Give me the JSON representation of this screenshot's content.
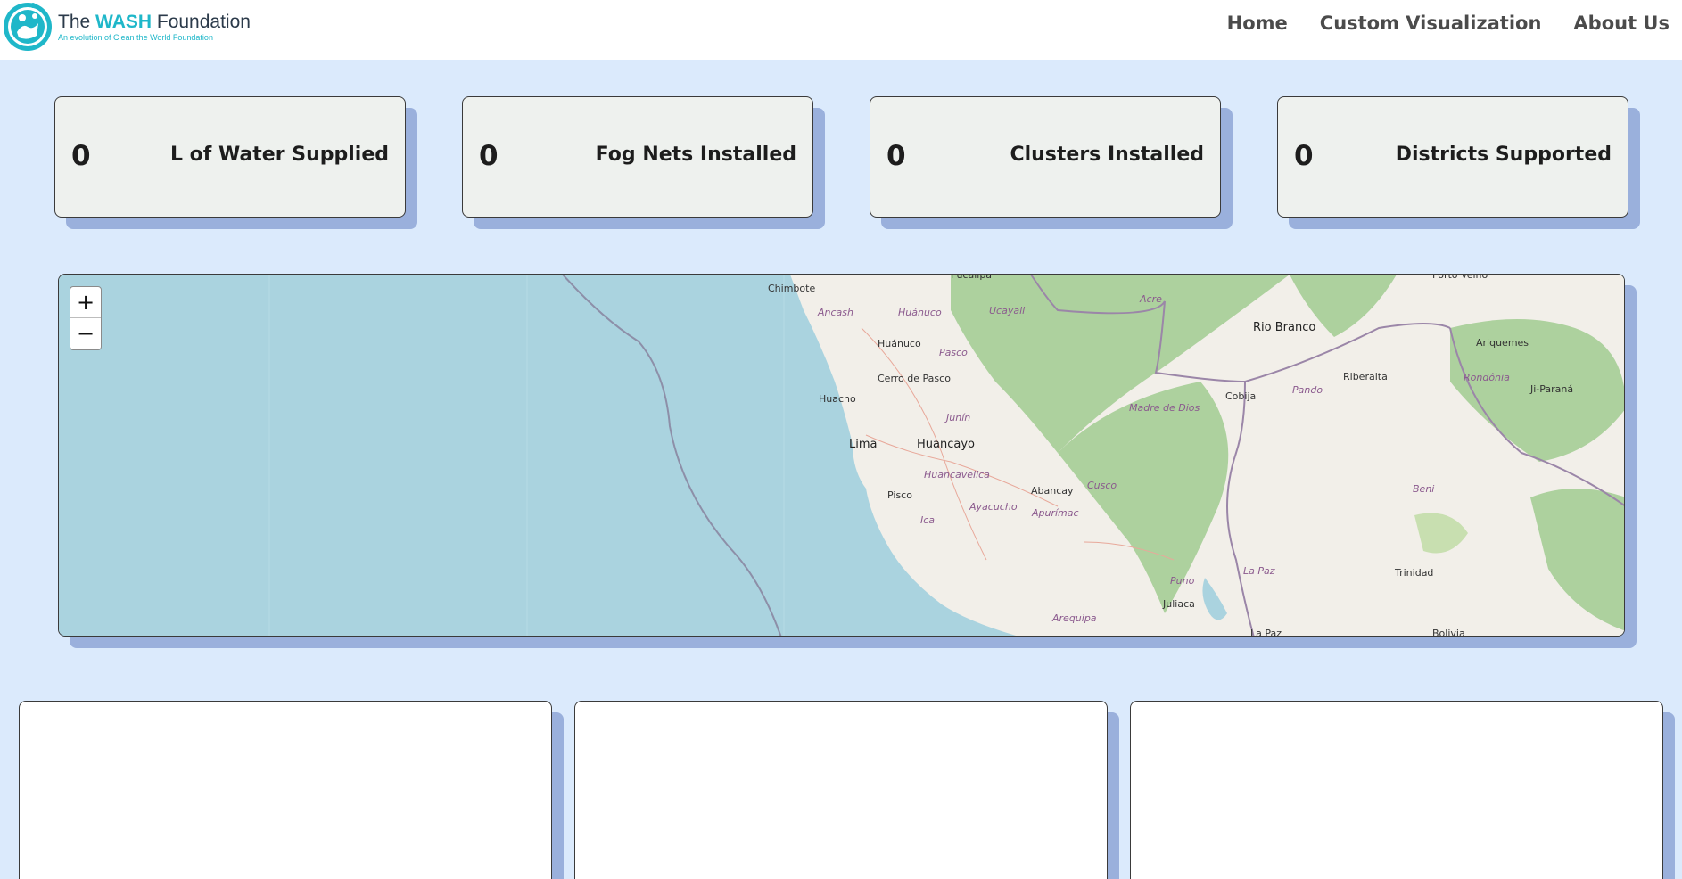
{
  "header": {
    "logo_prefix": "The ",
    "logo_highlight": "WASH",
    "logo_suffix": " Foundation",
    "logo_tagline": "An evolution of Clean the World Foundation",
    "nav": [
      "Home",
      "Custom Visualization",
      "About Us"
    ]
  },
  "stats": [
    {
      "value": "0",
      "label": "L of Water Supplied"
    },
    {
      "value": "0",
      "label": "Fog Nets Installed"
    },
    {
      "value": "0",
      "label": "Clusters Installed"
    },
    {
      "value": "0",
      "label": "Districts Supported"
    }
  ],
  "map": {
    "zoom_in": "+",
    "zoom_out": "−",
    "places": [
      "Pucallpa",
      "Chimbote",
      "Ancash",
      "Huánuco",
      "Ucayali",
      "Acre",
      "Porto Velho",
      "Rio Branco",
      "Huánuco",
      "Pasco",
      "Ariquemes",
      "Cerro de Pasco",
      "Riberalta",
      "Rondônia",
      "Ji-Paraná",
      "Huacho",
      "Cobija",
      "Pando",
      "Madre de Dios",
      "Junín",
      "Lima",
      "Huancayo",
      "Huancavelica",
      "Abancay",
      "Cusco",
      "Beni",
      "Pisco",
      "Ayacucho",
      "Apurímac",
      "Ica",
      "La Paz",
      "Puno",
      "Trinidad",
      "Juliaca",
      "Arequipa",
      "La Paz",
      "Bolivia"
    ]
  },
  "colors": {
    "accent": "#1fb7c9",
    "background": "#dbeafc",
    "shadow": "#9ab0dc",
    "card": "#eef1ee"
  }
}
